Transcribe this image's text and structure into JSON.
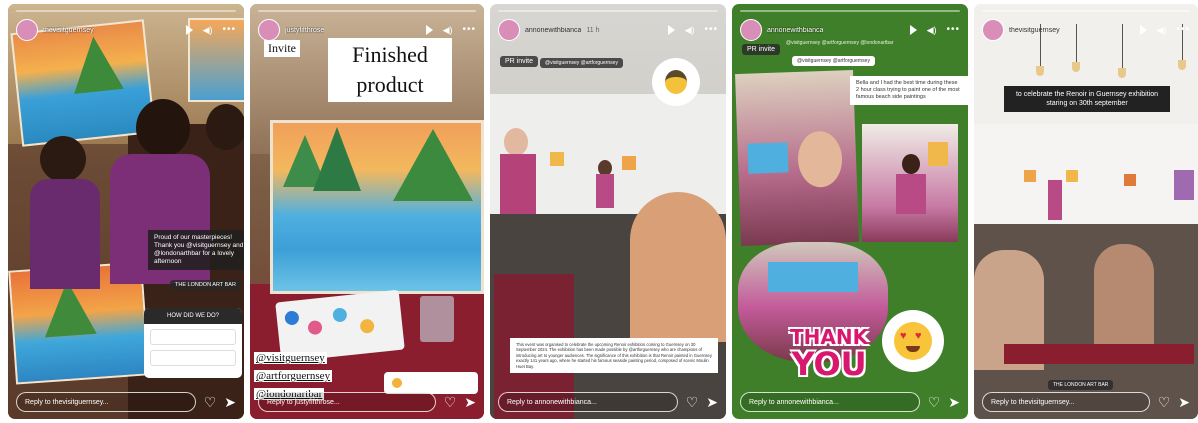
{
  "colors": {
    "green_bg": "#3f7f2a",
    "pink_text": "#d8186f",
    "caption_bg": "#1e1e1e"
  },
  "icons": {
    "play": "play-icon",
    "speaker": "speaker-icon",
    "more": "more-icon",
    "heart": "heart-icon",
    "send": "send-icon"
  },
  "stories": [
    {
      "username": "thevisitguernsey",
      "time": "",
      "caption": "Proud of our masterpieces! Thank you @visitguernsey and @londonarthbar for a lovely afternoon",
      "tag": "THE LONDON ART BAR",
      "question": "HOW DID WE DO?",
      "reply": "Reply to thevisitguernsey..."
    },
    {
      "username": "justyfifthrose",
      "time": "",
      "invite_label": "Invite",
      "title_line1": "Finished",
      "title_line2": "product",
      "mentions": [
        "@visitguernsey",
        "@artforguernsey",
        "@londonartbar"
      ],
      "reply": "Reply to justyfifthrose..."
    },
    {
      "username": "annonewithbianca",
      "time": "11 h",
      "pr_label": "PR invite",
      "handle": "@visitguernsey  @artforguernsey",
      "caption": "This event was organised to celebrate the upcoming Renoir exhibition coming to Guernsey on 30 September 2024. The exhibition has been made possible by @artforguernsey who are champions of introducing art to younger audiences. The significance of this exhibition is that Renoir painted in Guernsey exactly 141 years ago, where he started his famous seaside painting period, composed of scenic Moulin Huet Bay.",
      "reply": "Reply to annonewithbianca..."
    },
    {
      "username": "annonewithbianca",
      "time": "",
      "pr_label": "PR invite",
      "handle_top": "@visitguernsey  @artforguernsey  @londonartbar",
      "handle_mid": "@visitguernsey  @artforguernsey",
      "caption": "Bella and I had the best time during these 2 hour class trying to paint one of the most famous beach side paintings",
      "thank_line1": "THANK",
      "thank_line2": "YOU",
      "reply": "Reply to annonewithbianca..."
    },
    {
      "username": "thevisitguernsey",
      "time": "",
      "caption": "to celebrate the Renoir in Guernsey exhibition staring on 30th september",
      "tag": "THE LONDON ART BAR",
      "reply": "Reply to thevisitguernsey..."
    }
  ]
}
